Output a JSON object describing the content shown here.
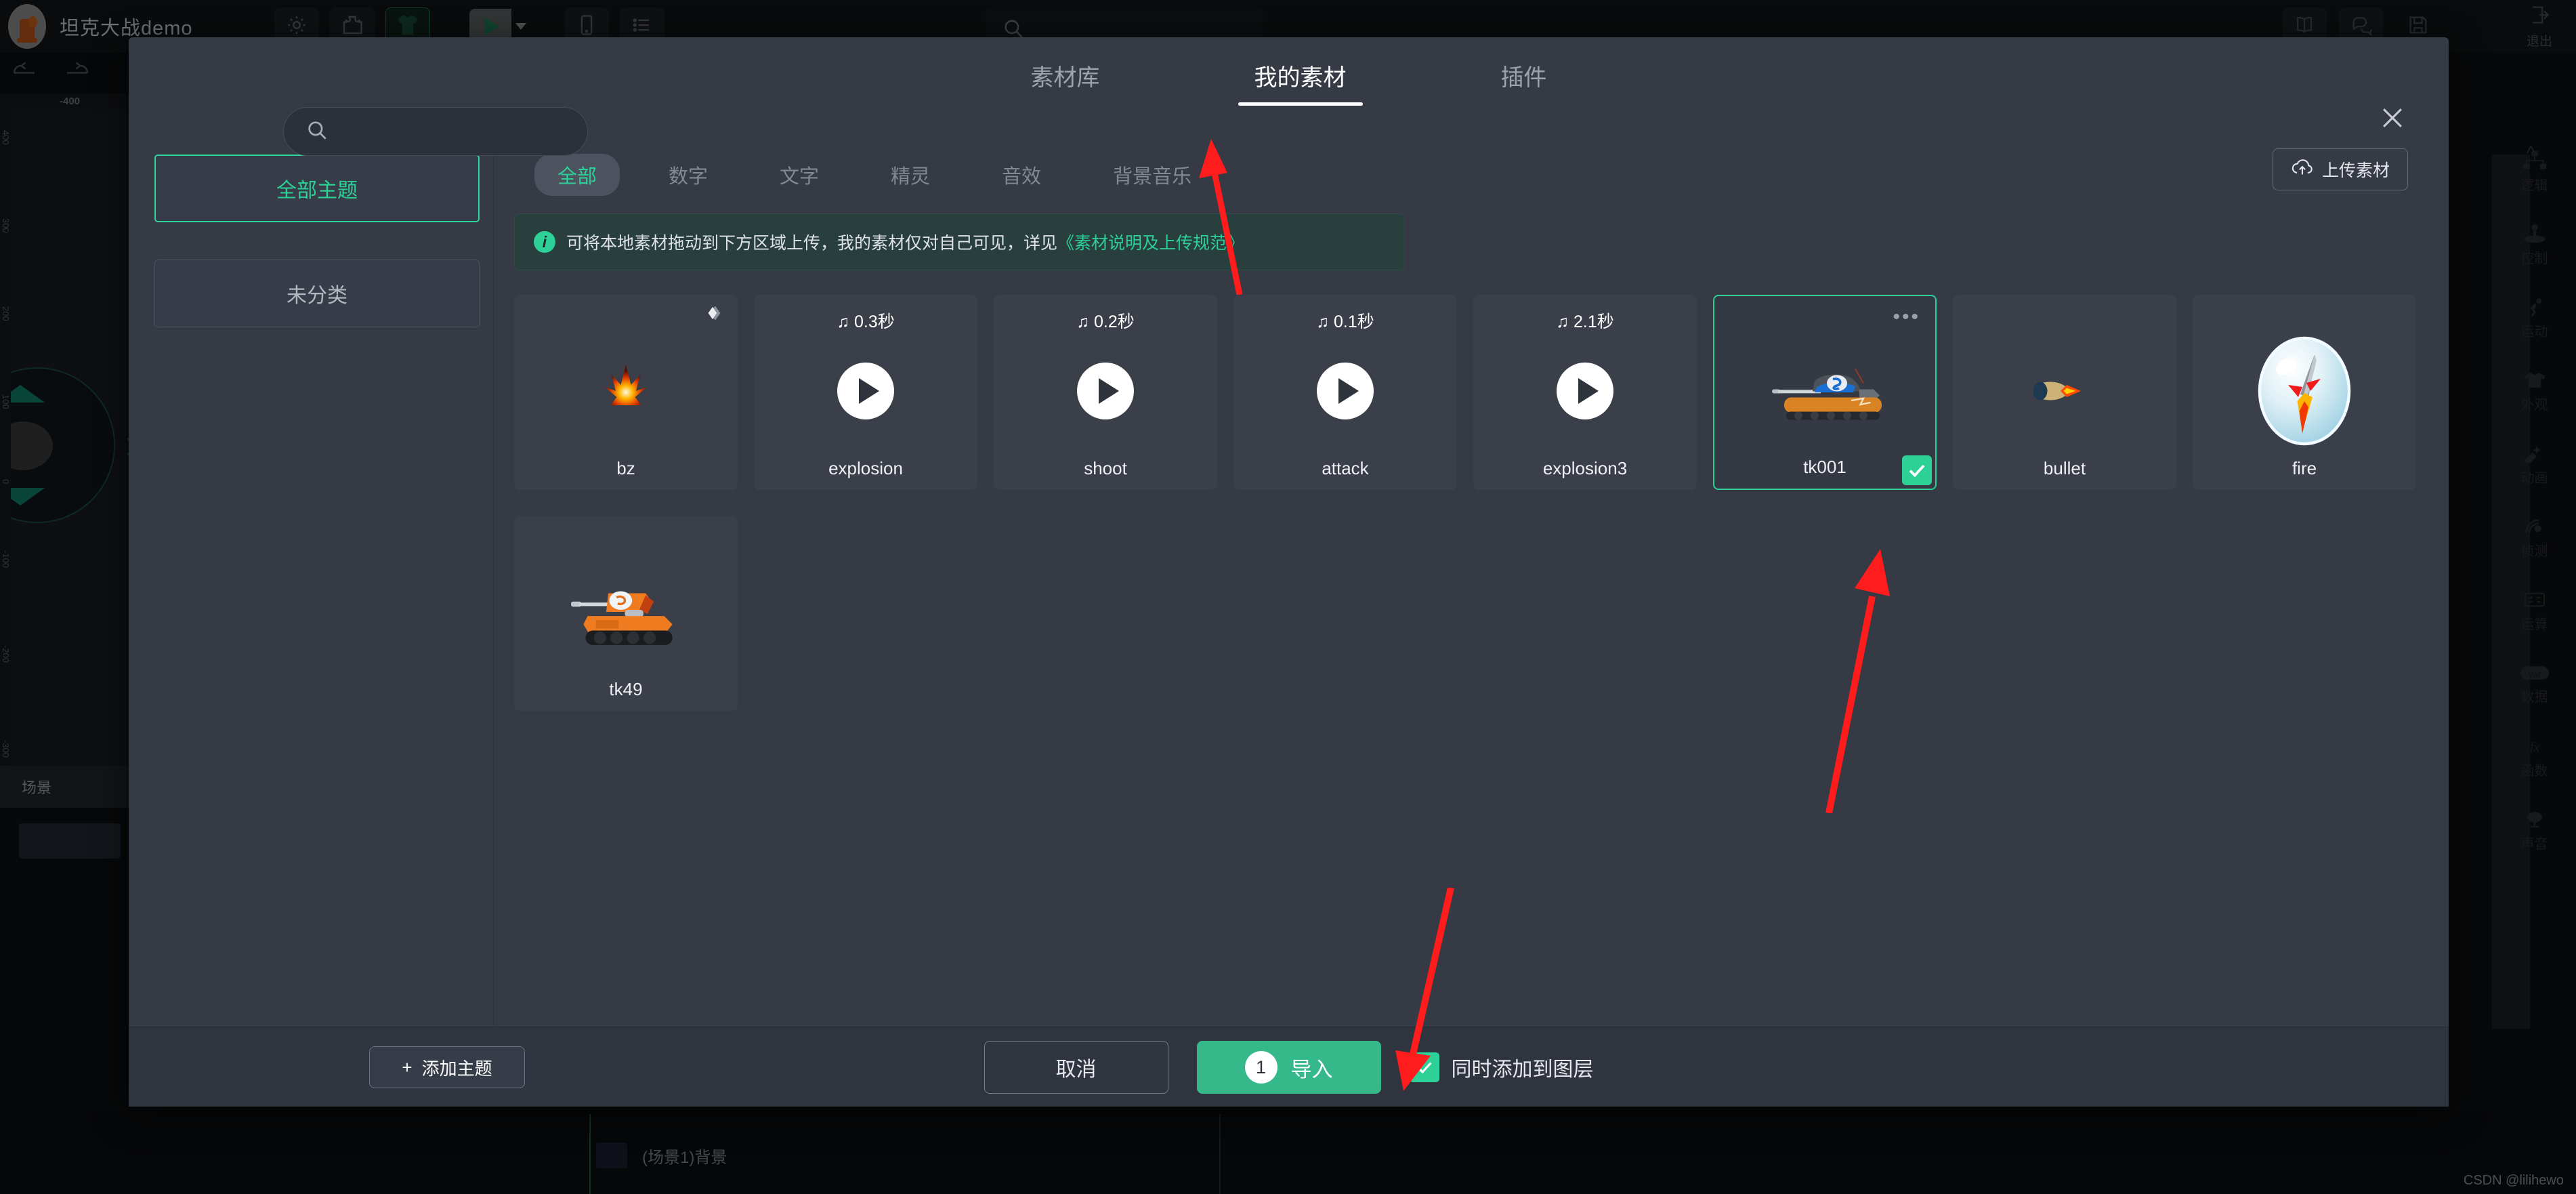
{
  "app": {
    "project_title": "坦克大战demo",
    "top_icons": [
      "gear-icon",
      "puzzle-icon",
      "tshirt-icon"
    ],
    "play_label": "play-icon",
    "right_icons": [
      "book-icon",
      "chat-icon",
      "save-icon",
      "exit-icon"
    ],
    "exit_label": "退出",
    "ruler_value": "-400",
    "ruler_v_marks": [
      "400",
      "300",
      "200",
      "100",
      "0",
      "-100",
      "-200",
      "-300"
    ],
    "scene_label": "场景",
    "layer_label": "(场景1)背景",
    "watermark": "CSDN @lilihewo",
    "right_sidebar": [
      {
        "label": "逻辑",
        "icon": "sitemap-icon"
      },
      {
        "label": "控制",
        "icon": "joystick-icon"
      },
      {
        "label": "运动",
        "icon": "runner-icon"
      },
      {
        "label": "外观",
        "icon": "tshirt-icon"
      },
      {
        "label": "动画",
        "icon": "star-wand-icon"
      },
      {
        "label": "侦测",
        "icon": "radar-icon"
      },
      {
        "label": "运算",
        "icon": "calculator-icon"
      },
      {
        "label": "数据",
        "icon": "var-icon"
      },
      {
        "label": "函数",
        "icon": "fx-icon"
      },
      {
        "label": "声音",
        "icon": "mic-icon"
      }
    ]
  },
  "modal": {
    "search": {
      "value": "",
      "placeholder": ""
    },
    "tabs": [
      {
        "label": "素材库",
        "active": false
      },
      {
        "label": "我的素材",
        "active": true
      },
      {
        "label": "插件",
        "active": false
      }
    ],
    "close_icon": "close-icon",
    "themes": [
      {
        "label": "全部主题",
        "active": true
      },
      {
        "label": "未分类",
        "active": false
      }
    ],
    "chips": [
      {
        "label": "全部",
        "active": true
      },
      {
        "label": "数字",
        "active": false
      },
      {
        "label": "文字",
        "active": false
      },
      {
        "label": "精灵",
        "active": false
      },
      {
        "label": "音效",
        "active": false
      },
      {
        "label": "背景音乐",
        "active": false
      }
    ],
    "upload_button": "上传素材",
    "banner": {
      "text": "可将本地素材拖动到下方区域上传，我的素材仅对自己可见，详见",
      "link": "《素材说明及上传规范》"
    },
    "assets": [
      {
        "name": "bz",
        "type": "sprite",
        "meta": "",
        "selected": false,
        "badge": "gem"
      },
      {
        "name": "explosion",
        "type": "audio",
        "meta": "0.3秒",
        "selected": false,
        "badge": ""
      },
      {
        "name": "shoot",
        "type": "audio",
        "meta": "0.2秒",
        "selected": false,
        "badge": ""
      },
      {
        "name": "attack",
        "type": "audio",
        "meta": "0.1秒",
        "selected": false,
        "badge": ""
      },
      {
        "name": "explosion3",
        "type": "audio",
        "meta": "2.1秒",
        "selected": false,
        "badge": ""
      },
      {
        "name": "tk001",
        "type": "sprite",
        "meta": "",
        "selected": true,
        "badge": "dots"
      },
      {
        "name": "bullet",
        "type": "sprite",
        "meta": "",
        "selected": false,
        "badge": ""
      },
      {
        "name": "fire",
        "type": "sprite",
        "meta": "",
        "selected": false,
        "badge": ""
      },
      {
        "name": "tk49",
        "type": "sprite",
        "meta": "",
        "selected": false,
        "badge": ""
      }
    ],
    "footer": {
      "add_theme": "添加主题",
      "cancel": "取消",
      "import": "导入",
      "import_count": "1",
      "checkbox_label": "同时添加到图层",
      "checkbox_checked": true
    }
  },
  "colors": {
    "accent_green": "#2dd197",
    "import_green": "#35b98b",
    "modal_bg": "#353a45",
    "card_bg": "#3a3f49",
    "annotation_red": "#ff1c1c"
  }
}
